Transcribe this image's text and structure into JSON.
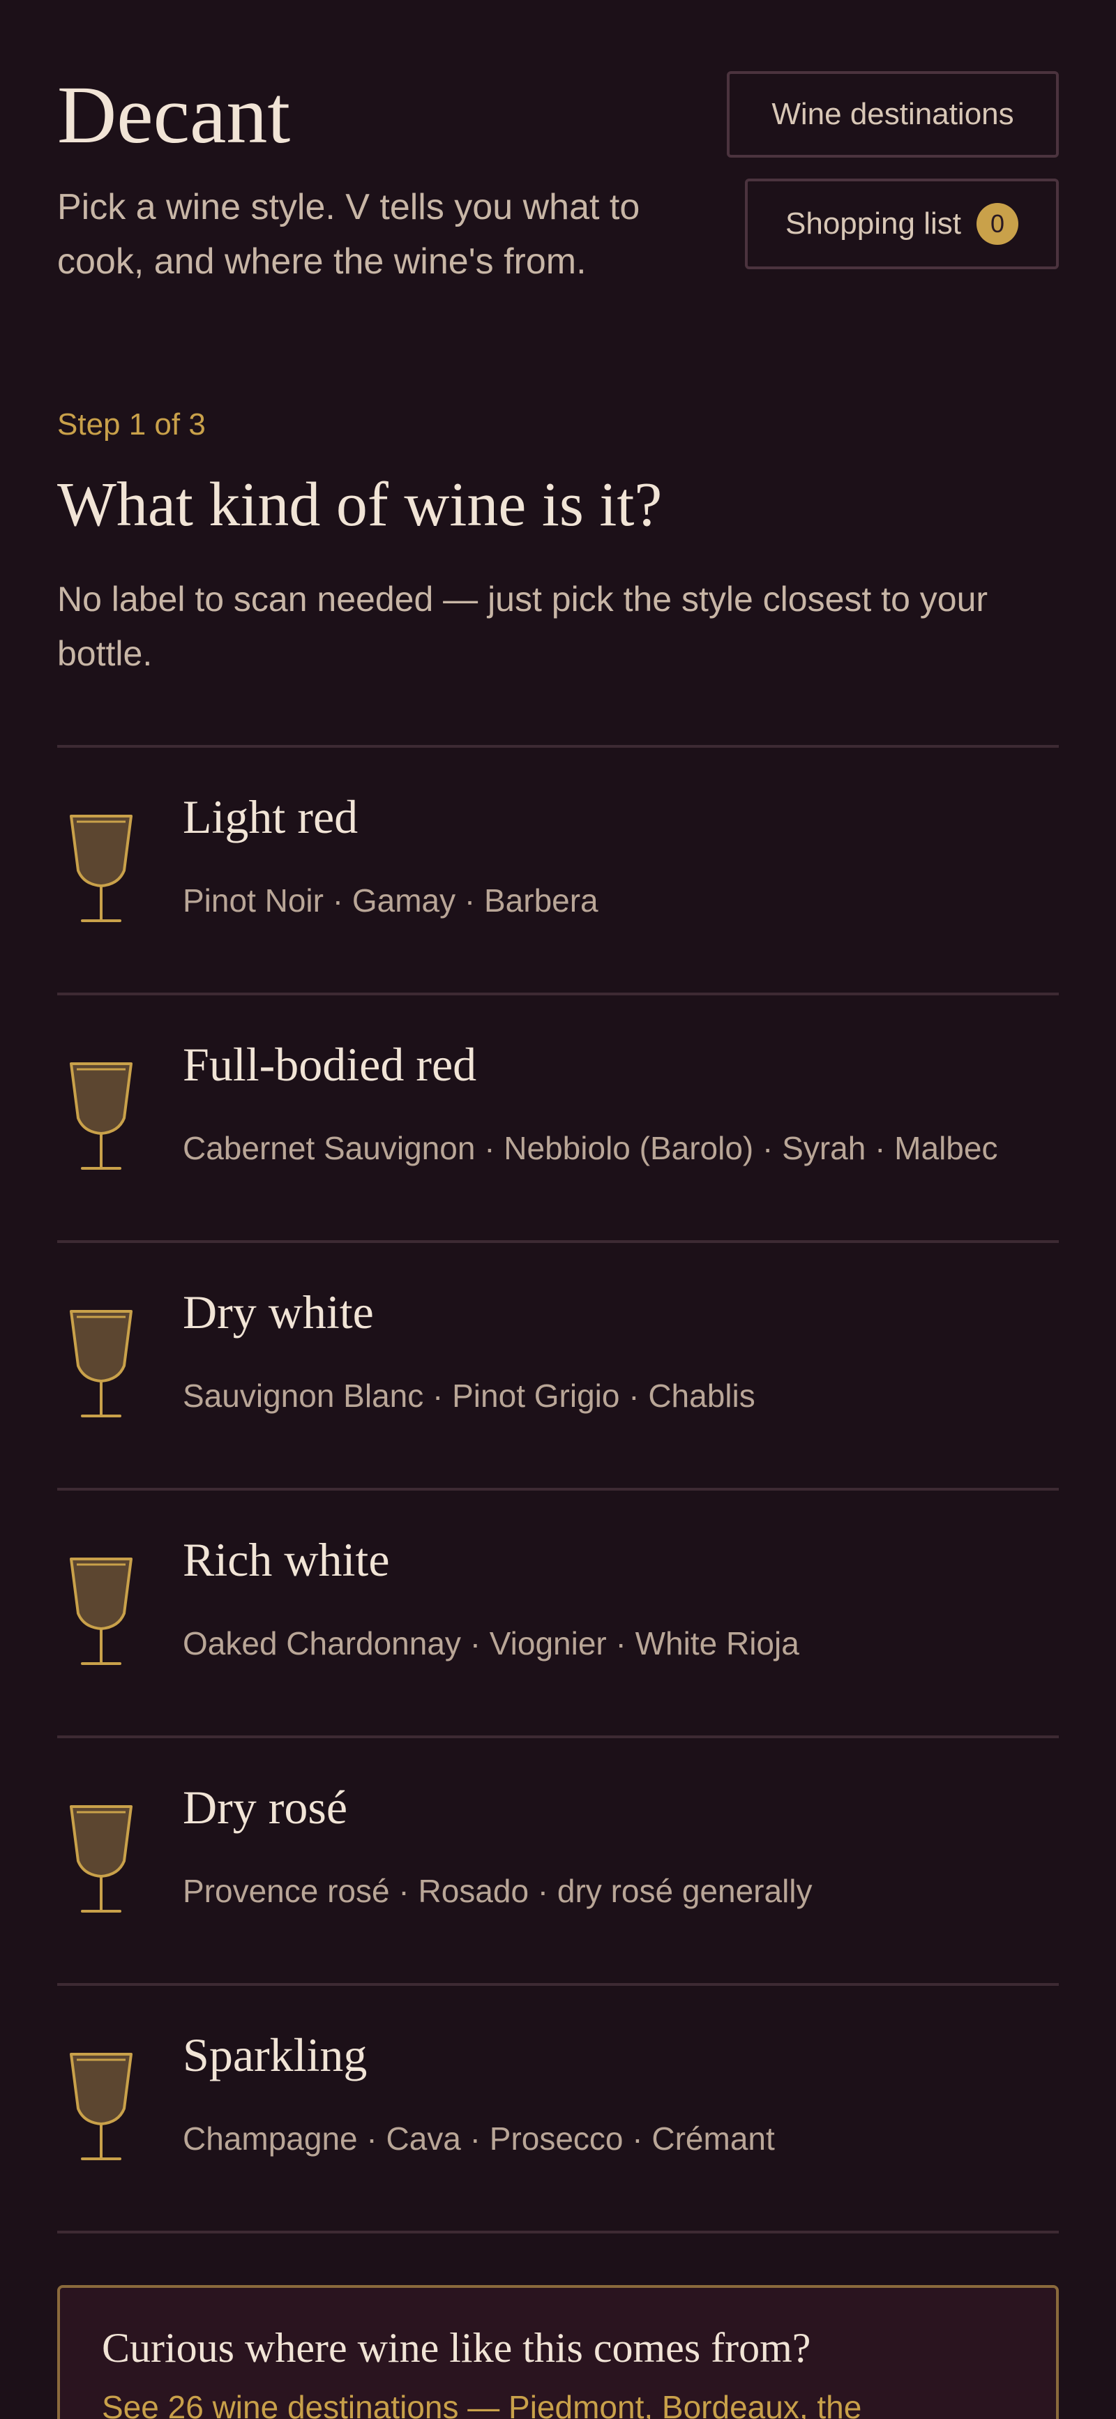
{
  "header": {
    "title": "Decant",
    "tagline": "Pick a wine style. V tells you what to cook, and where the wine's from.",
    "destinations_button": "Wine destinations",
    "shopping_button": "Shopping list",
    "shopping_count": "0"
  },
  "step": {
    "label": "Step 1 of 3",
    "title": "What kind of wine is it?",
    "description": "No label to scan needed — just pick the style closest to your bottle."
  },
  "styles": [
    {
      "name": "Light red",
      "grapes": "Pinot Noir · Gamay · Barbera",
      "icon": "wine-glass-icon"
    },
    {
      "name": "Full-bodied red",
      "grapes": "Cabernet Sauvignon · Nebbiolo (Barolo) · Syrah · Malbec",
      "icon": "wine-glass-icon"
    },
    {
      "name": "Dry white",
      "grapes": "Sauvignon Blanc · Pinot Grigio · Chablis",
      "icon": "wine-glass-icon"
    },
    {
      "name": "Rich white",
      "grapes": "Oaked Chardonnay · Viognier · White Rioja",
      "icon": "wine-glass-icon"
    },
    {
      "name": "Dry rosé",
      "grapes": "Provence rosé · Rosado · dry rosé generally",
      "icon": "wine-glass-icon"
    },
    {
      "name": "Sparkling",
      "grapes": "Champagne · Cava · Prosecco · Crémant",
      "icon": "wine-glass-icon"
    }
  ],
  "callout": {
    "title": "Curious where wine like this comes from?",
    "link": "See 26 wine destinations — Piedmont, Bordeaux, the"
  },
  "colors": {
    "background": "#1c1018",
    "accent": "#c9a14a",
    "divider": "#3d2a33"
  }
}
